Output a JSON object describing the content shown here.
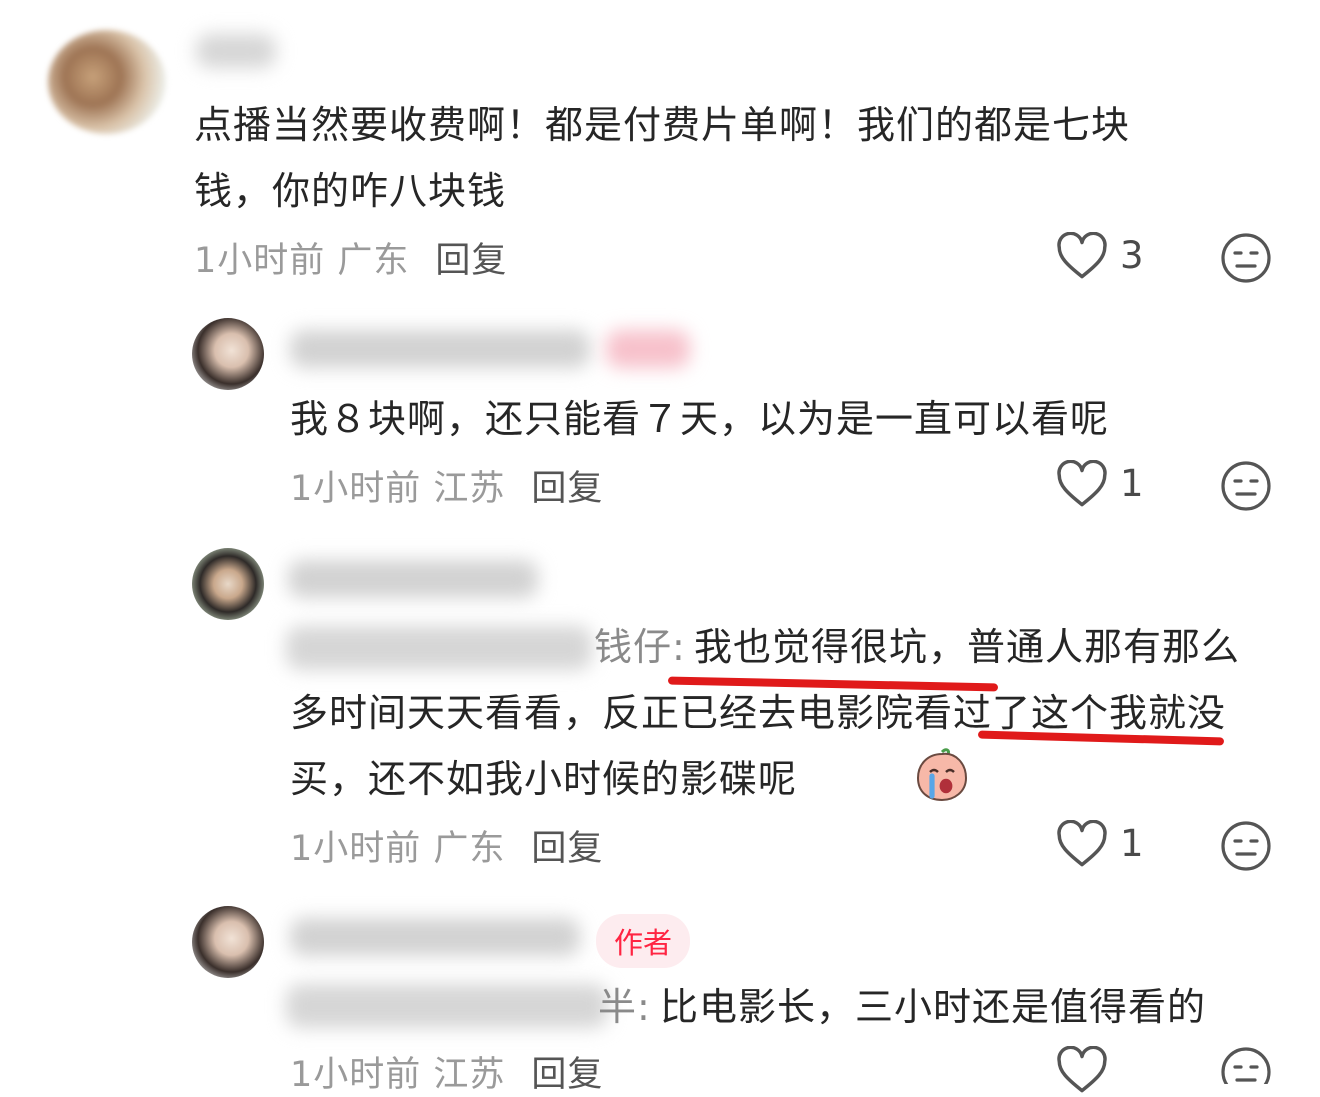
{
  "comments": [
    {
      "content": "点播当然要收费啊！都是付费片单啊！我们的都是七块钱，你的咋八块钱",
      "meta": "1小时前 广东",
      "reply_label": "回复",
      "likes": "3"
    },
    {
      "content": "我８块啊，还只能看７天，以为是一直可以看呢",
      "meta": "1小时前 江苏",
      "reply_label": "回复",
      "likes": "1"
    },
    {
      "reply_prefix_visible": "钱仔:",
      "content": "我也觉得很坑，普通人那有那么多时间天天看看，反正已经去电影院看过了这个我就没买，还不如我小时候的影碟呢",
      "meta": "1小时前 广东",
      "reply_label": "回复",
      "likes": "1"
    },
    {
      "author_tag": "作者",
      "reply_prefix_visible": "半:",
      "content": "比电影长，三小时还是值得看的",
      "meta": "1小时前 江苏",
      "reply_label": "回复"
    }
  ],
  "icons": {
    "like": "heart-outline-icon",
    "dislike": "neutral-face-icon"
  },
  "colors": {
    "tag_text": "#ff2442",
    "tag_bg": "#fdecef",
    "annotation_mark": "#e01a1a"
  }
}
